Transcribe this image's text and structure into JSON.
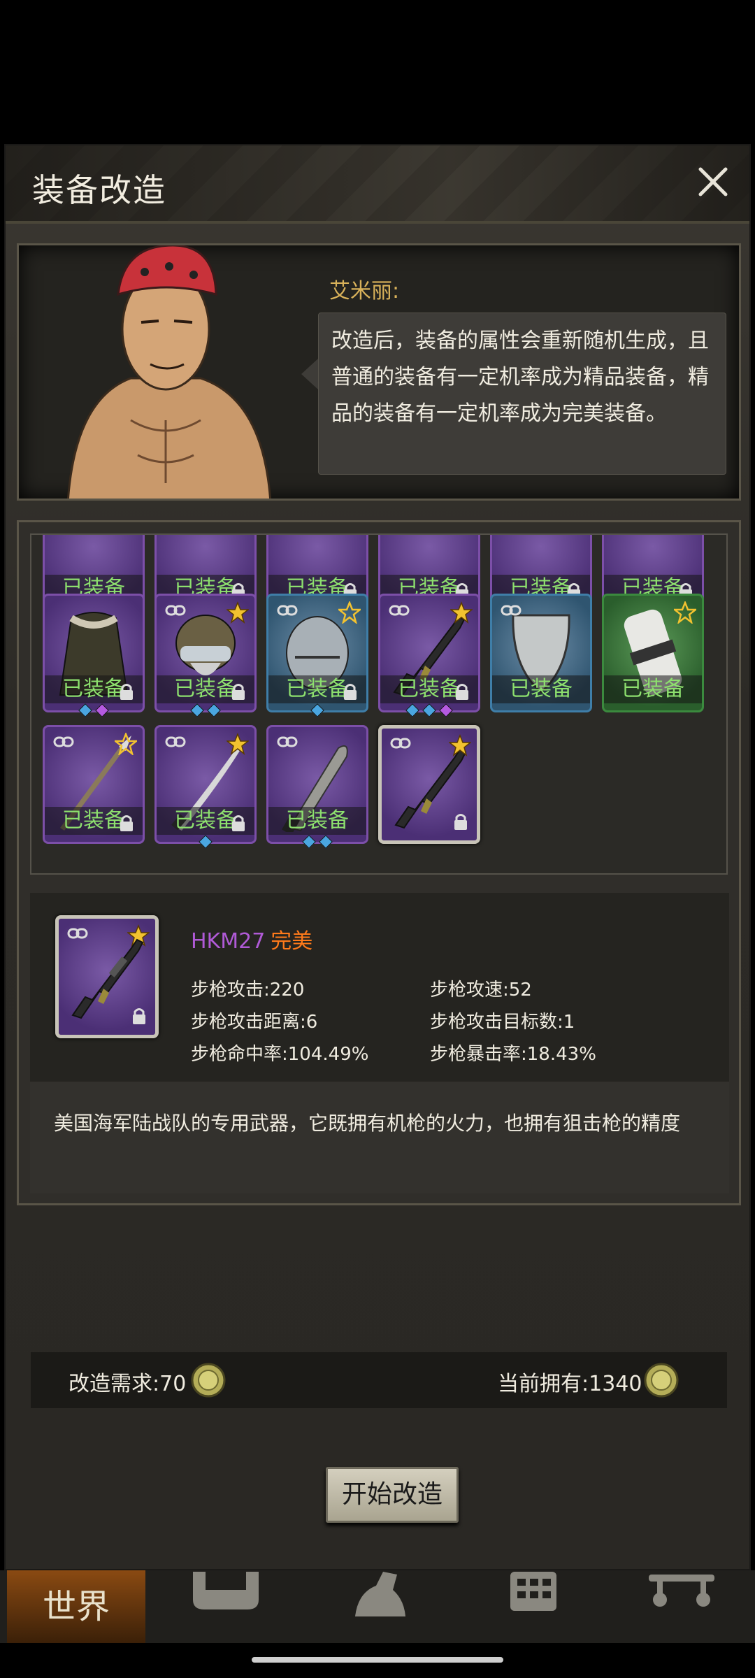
{
  "window": {
    "title": "装备改造"
  },
  "npc": {
    "name": "艾米丽:",
    "speech": "改造后，装备的属性会重新随机生成，且普通的装备有一定机率成为精品装备，精品的装备有一定机率成为完美装备。"
  },
  "inventory": {
    "equipped_label": "已装备",
    "rows": [
      [
        {
          "color": "purple",
          "equipped": true,
          "lock": false,
          "gems": []
        },
        {
          "color": "purple",
          "equipped": true,
          "lock": true,
          "gems": [
            "p"
          ]
        },
        {
          "color": "purple",
          "equipped": true,
          "lock": true,
          "gems": [
            "p",
            "b"
          ]
        },
        {
          "color": "purple",
          "equipped": true,
          "lock": true,
          "gems": []
        },
        {
          "color": "purple",
          "equipped": true,
          "lock": true,
          "gems": []
        },
        {
          "color": "purple",
          "equipped": true,
          "lock": true,
          "gems": [
            "b"
          ]
        }
      ],
      [
        {
          "color": "purple",
          "art": "coat-icon",
          "equipped": true,
          "lock": true,
          "star": "none",
          "link": false,
          "gems": [
            "b",
            "p"
          ]
        },
        {
          "color": "purple",
          "art": "helmet-goggles-icon",
          "equipped": true,
          "lock": true,
          "star": "gold",
          "link": true,
          "gems": [
            "b",
            "b"
          ]
        },
        {
          "color": "blue",
          "art": "helmet-icon",
          "equipped": true,
          "lock": true,
          "star": "outline",
          "link": true,
          "gems": [
            "b"
          ]
        },
        {
          "color": "purple",
          "art": "rifle-icon",
          "equipped": true,
          "lock": true,
          "star": "gold",
          "link": true,
          "gems": [
            "b",
            "b",
            "p"
          ]
        },
        {
          "color": "blue",
          "art": "shield-icon",
          "equipped": true,
          "lock": false,
          "star": "none",
          "link": true,
          "gems": []
        },
        {
          "color": "green",
          "art": "bandage-icon",
          "equipped": true,
          "lock": false,
          "star": "outline",
          "link": false,
          "gems": []
        }
      ],
      [
        {
          "color": "purple",
          "art": "spear-icon",
          "equipped": true,
          "lock": true,
          "star": "outline",
          "link": true,
          "gems": []
        },
        {
          "color": "purple",
          "art": "katana-icon",
          "equipped": true,
          "lock": true,
          "star": "gold",
          "link": true,
          "gems": [
            "b"
          ]
        },
        {
          "color": "purple",
          "art": "machete-icon",
          "equipped": true,
          "lock": false,
          "star": "none",
          "link": true,
          "gems": [
            "b",
            "b"
          ]
        },
        {
          "color": "purple",
          "art": "rifle-icon",
          "equipped": false,
          "lock": true,
          "star": "gold",
          "link": true,
          "gems": [],
          "selected": true
        }
      ]
    ]
  },
  "selected_item": {
    "name": "HKM27",
    "quality": "完美",
    "stats": [
      {
        "label": "步枪攻击",
        "value": "220"
      },
      {
        "label": "步枪攻速",
        "value": "52"
      },
      {
        "label": "步枪攻击距离",
        "value": "6"
      },
      {
        "label": "步枪攻击目标数",
        "value": "1"
      },
      {
        "label": "步枪命中率",
        "value": "104.49%"
      },
      {
        "label": "步枪暴击率",
        "value": "18.43%"
      }
    ],
    "description": "美国海军陆战队的专用武器，它既拥有机枪的火力，也拥有狙击枪的精度"
  },
  "cost": {
    "required_label": "改造需求:",
    "required_value": "70",
    "owned_label": "当前拥有:",
    "owned_value": "1340"
  },
  "actions": {
    "start": "开始改造"
  },
  "nav": {
    "world": "世界"
  },
  "colors": {
    "purple_rarity": "#7c4fa8",
    "blue_rarity": "#3f7ea8",
    "green_rarity": "#3b8a3e",
    "equipped_text": "#8de06e",
    "perfect_quality": "#ff7a1a"
  }
}
